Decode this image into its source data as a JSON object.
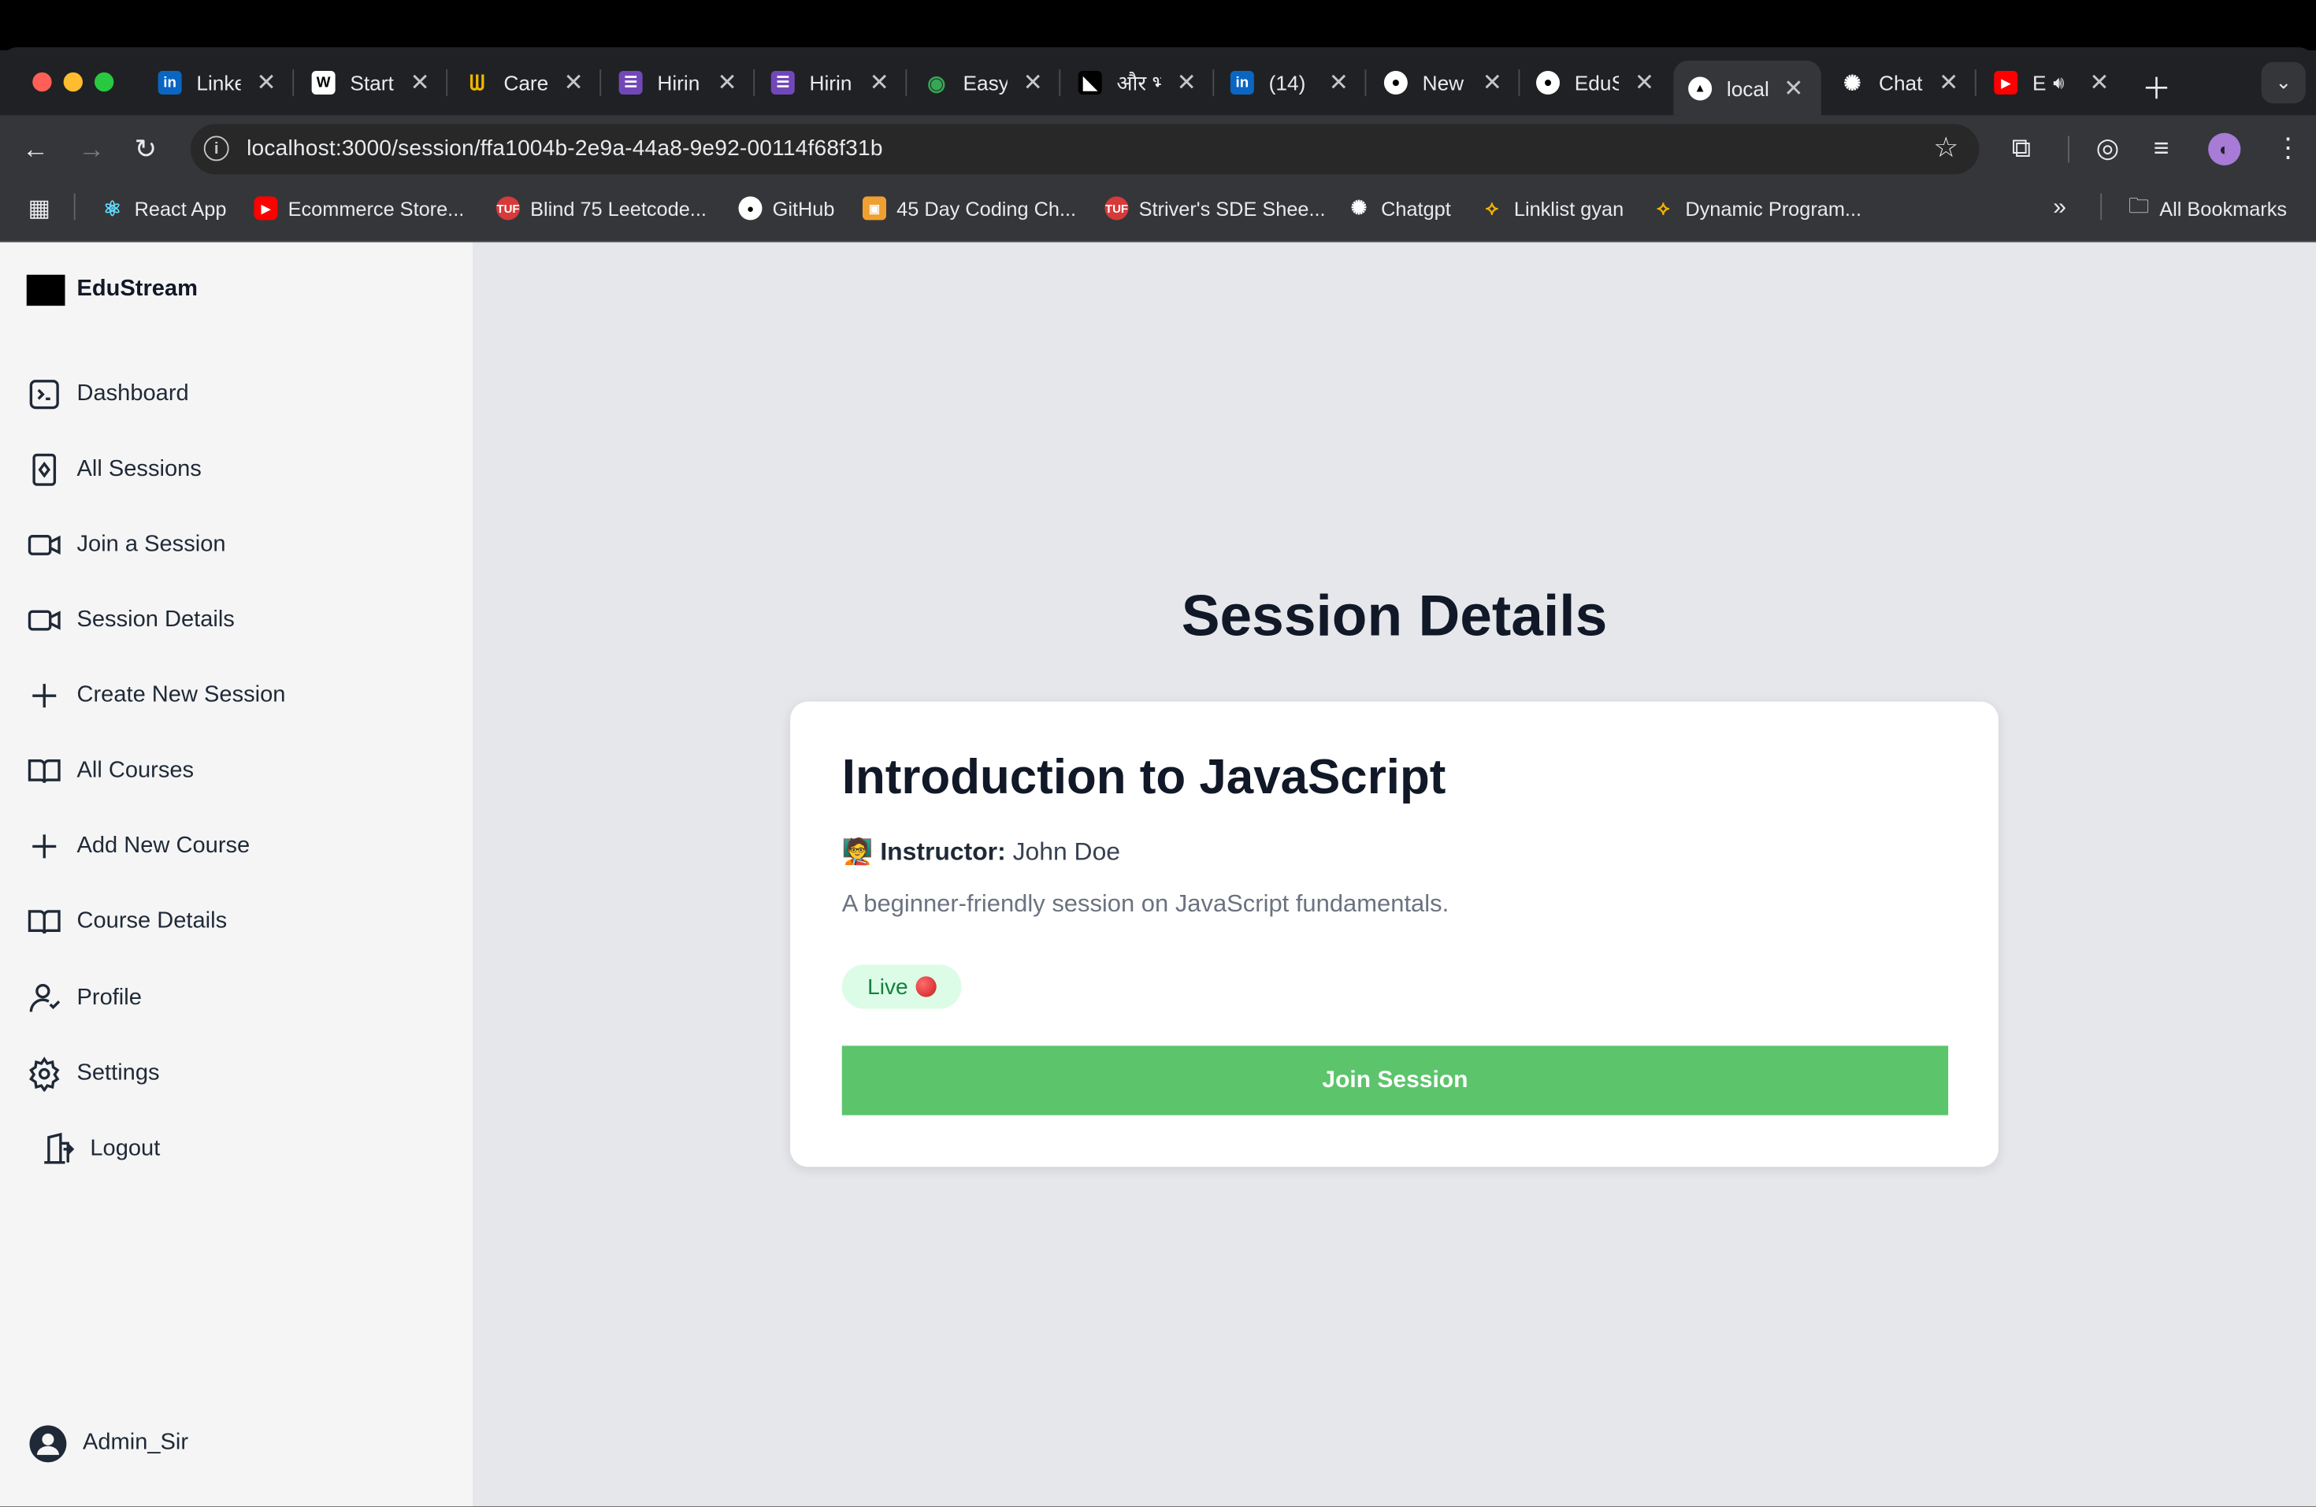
{
  "browser": {
    "tabs": [
      {
        "label": "Linke",
        "icon": "linkedin-icon",
        "color": "#0a66c2"
      },
      {
        "label": "Start",
        "icon": "wellfound-icon",
        "color": "#ffffff"
      },
      {
        "label": "Care",
        "icon": "careers-icon",
        "color": "#1f6feb"
      },
      {
        "label": "Hirin",
        "icon": "forms-icon",
        "color": "#7248b9"
      },
      {
        "label": "Hirin",
        "icon": "forms-icon",
        "color": "#7248b9"
      },
      {
        "label": "Easy",
        "icon": "easy-icon",
        "color": "#34a853"
      },
      {
        "label": "और भी",
        "icon": "youtube-channel-icon",
        "color": "#000000"
      },
      {
        "label": "(14)",
        "icon": "linkedin-icon",
        "color": "#0a66c2"
      },
      {
        "label": "New",
        "icon": "github-icon",
        "color": "#ffffff"
      },
      {
        "label": "EduS",
        "icon": "github-icon",
        "color": "#ffffff"
      },
      {
        "label": "local",
        "icon": "vercel-icon",
        "color": "#ffffff"
      },
      {
        "label": "Chat",
        "icon": "chatgpt-icon",
        "color": "#ffffff"
      },
      {
        "label": "E",
        "icon": "youtube-icon",
        "color": "#ff0000"
      }
    ],
    "url": "localhost:3000/session/ffa1004b-2e9a-44a8-9e92-00114f68f31b",
    "bookmarks": [
      {
        "label": "React App",
        "icon": "react-icon"
      },
      {
        "label": "Ecommerce Store...",
        "icon": "youtube-icon"
      },
      {
        "label": "Blind 75 Leetcode...",
        "icon": "tuf-icon"
      },
      {
        "label": "GitHub",
        "icon": "github-icon"
      },
      {
        "label": "45 Day Coding Ch...",
        "icon": "coding-icon"
      },
      {
        "label": "Striver's SDE Shee...",
        "icon": "tuf-icon"
      },
      {
        "label": "Chatgpt",
        "icon": "chatgpt-icon"
      },
      {
        "label": "Linklist gyan",
        "icon": "linklist-icon"
      },
      {
        "label": "Dynamic Program...",
        "icon": "linklist-icon"
      }
    ],
    "all_bookmarks": "All Bookmarks"
  },
  "app": {
    "brand": "EduStream",
    "nav": [
      {
        "label": "Dashboard",
        "icon": "terminal-icon"
      },
      {
        "label": "All Sessions",
        "icon": "session-card-icon"
      },
      {
        "label": "Join a Session",
        "icon": "video-icon"
      },
      {
        "label": "Session Details",
        "icon": "video-icon"
      },
      {
        "label": "Create New Session",
        "icon": "plus-icon"
      },
      {
        "label": "All Courses",
        "icon": "book-icon"
      },
      {
        "label": "Add New Course",
        "icon": "plus-icon"
      },
      {
        "label": "Course Details",
        "icon": "book-icon"
      },
      {
        "label": "Profile",
        "icon": "user-icon"
      },
      {
        "label": "Settings",
        "icon": "gear-icon"
      },
      {
        "label": "Logout",
        "icon": "logout-icon"
      }
    ],
    "user": "Admin_Sir"
  },
  "main": {
    "heading": "Session Details",
    "session": {
      "title": "Introduction to JavaScript",
      "instructor_label": "Instructor:",
      "instructor_name": "John Doe",
      "description": "A beginner-friendly session on JavaScript fundamentals.",
      "status": "Live",
      "join_label": "Join Session"
    }
  },
  "colors": {
    "accent_green": "#5cc46b",
    "badge_bg": "#dcfce7",
    "badge_text": "#15803d"
  }
}
